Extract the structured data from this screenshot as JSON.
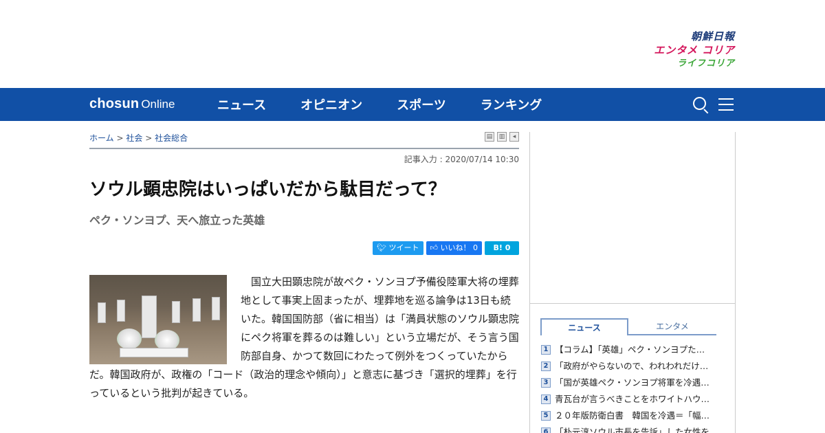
{
  "brands": {
    "chosun": "朝鮮日報",
    "entame": "エンタメ コリア",
    "life": "ライフコリア"
  },
  "nav": {
    "logo_bold": "chosun",
    "logo_thin": "Online",
    "menu": [
      "ニュース",
      "オピニオン",
      "スポーツ",
      "ランキング"
    ],
    "icons": [
      "search-icon",
      "hamburger-menu-icon"
    ]
  },
  "breadcrumb": {
    "home": "ホーム",
    "sep": ">",
    "section": "社会",
    "subsection": "社会総合"
  },
  "article": {
    "dateline": "記事入力 : 2020/07/14 10:30",
    "title": "ソウル顕忠院はいっぱいだから駄目だって？",
    "subtitle": "ペク・ソンヨプ、天へ旅立った英雄",
    "body": "　国立大田顕忠院が故ペク・ソンヨプ予備役陸軍大将の埋葬地として事実上固まったが、埋葬地を巡る論争は13日も続いた。韓国国防部（省に相当）は「満員状態のソウル顕忠院にペク将軍を葬るのは難しい」という立場だが、そう言う国防部自身、かつて数回にわたって例外をつくっていたからだ。韓国政府が、政権の「コード（政治的理念や傾向）」と意志に基づき「選択的埋葬」を行っているという批判が起きている。"
  },
  "share": {
    "tweet": "ツイート",
    "like": "いいね！ 0",
    "hatena": "B! 0"
  },
  "sidebar": {
    "tabs": [
      "ニュース",
      "エンタメ"
    ],
    "ranking": [
      {
        "num": "1",
        "text": "【コラム】「英雄」ペク・ソンヨプた…"
      },
      {
        "num": "2",
        "text": "「政府がやらないので、われわれだけ…"
      },
      {
        "num": "3",
        "text": "「国が英雄ペク・ソンヨプ将軍を冷遇…"
      },
      {
        "num": "4",
        "text": "青瓦台が言うべきことをホワイトハウ…"
      },
      {
        "num": "5",
        "text": "２０年版防衛白書　韓国を冷遇＝「幅…"
      },
      {
        "num": "6",
        "text": "「朴元淳ソウル市長を告訴」した女性を…"
      }
    ]
  }
}
